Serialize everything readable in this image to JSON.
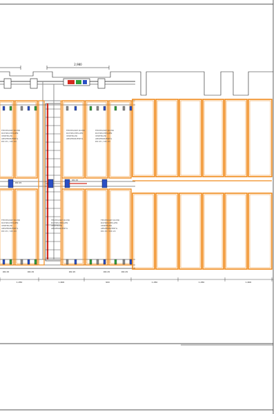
{
  "sheet": {
    "colors": {
      "orange": "#f08a1c",
      "red": "#d42a1f",
      "green": "#2f9e3b",
      "blue": "#2a4fc4",
      "grey": "#8c8c8c",
      "line": "#1a1a1a"
    }
  },
  "top_dimension": {
    "label": "2,980"
  },
  "bottom_dimensions": [
    {
      "label": "1,050"
    },
    {
      "label": "1,600"
    },
    {
      "label": "900"
    },
    {
      "label": "1,050"
    },
    {
      "label": "1,050"
    },
    {
      "label": "1,600"
    }
  ],
  "tag_labels": [
    {
      "text": "DN 25"
    },
    {
      "text": "DN 25"
    },
    {
      "text": "DN 25"
    },
    {
      "text": "DN 25"
    },
    {
      "text": "DN 25"
    }
  ],
  "mid_tags": [
    {
      "text": "DN 25"
    },
    {
      "text": "DN 25"
    }
  ],
  "bay_notes": [
    {
      "lines": [
        "FESTPUNKT ROHR",
        "ROHRSCHELLEN",
        "VERTEILER",
        "ABSPERRVENTIL",
        "DN 25 / DN 20"
      ]
    },
    {
      "lines": [
        "FESTPUNKT ROHR",
        "ROHRSCHELLEN",
        "VERTEILER",
        "ABSPERRVENTIL"
      ]
    },
    {
      "lines": [
        "FESTPUNKT ROHR",
        "ROHRSCHELLEN",
        "VERTEILER",
        "ABSPERRVENTIL",
        "DN 25 / DN 20"
      ]
    },
    {
      "lines": [
        "FESTPUNKT ROHR",
        "ROHRSCHELLEN",
        "VERTEILER",
        "ABSPERRVENTIL",
        "DN 25 / DN 20"
      ]
    },
    {
      "lines": [
        "FESTPUNKT ROHR",
        "ROHRSCHELLEN",
        "VERTEILER",
        "ABSPERRVENTIL"
      ]
    },
    {
      "lines": [
        "FESTPUNKT ROHR",
        "ROHRSCHELLEN",
        "VERTEILER",
        "ABSPERRVENTIL",
        "DN 25 / DN 20"
      ]
    }
  ]
}
